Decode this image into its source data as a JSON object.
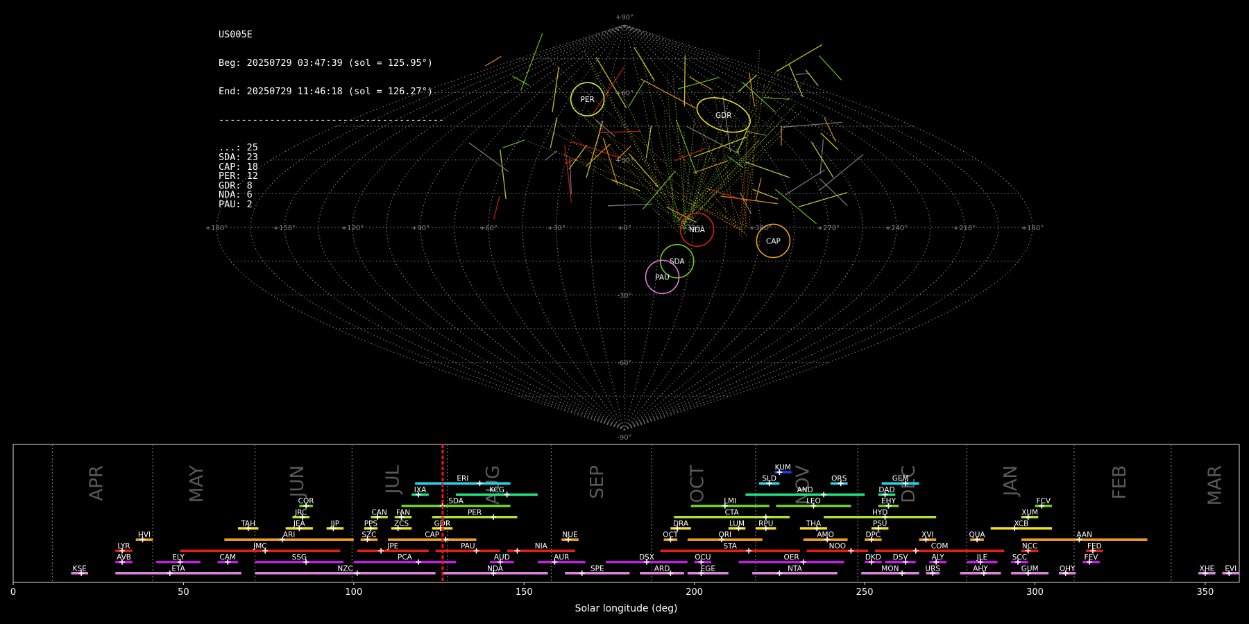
{
  "stats": {
    "station": "US005E",
    "beg": "Beg: 20250729 03:47:39 (sol = 125.95°)",
    "end": "End: 20250729 11:46:18 (sol = 126.27°)",
    "separator": "----------------------------------------",
    "counts": [
      {
        "code": "...",
        "count": 25
      },
      {
        "code": "SDA",
        "count": 23
      },
      {
        "code": "CAP",
        "count": 18
      },
      {
        "code": "PER",
        "count": 12
      },
      {
        "code": "GDR",
        "count": 8
      },
      {
        "code": "NDA",
        "count": 6
      },
      {
        "code": "PAU",
        "count": 2
      }
    ]
  },
  "chart_data": [
    {
      "type": "scatter",
      "projection": "sinusoidal",
      "lon_range": [
        180,
        -180
      ],
      "lat_range": [
        -90,
        90
      ],
      "lon_tick_labels": [
        "+180°",
        "+150°",
        "+120°",
        "+90°",
        "+60°",
        "+30°",
        "+0°",
        "+330°",
        "+300°",
        "+270°",
        "+240°",
        "+210°",
        "+180°"
      ],
      "lat_tick_labels": [
        "+90°",
        "+60°",
        "+30°",
        "+0°",
        "-30°",
        "-60°",
        "-90°"
      ],
      "grid": true,
      "radiants": [
        {
          "name": "PER",
          "lon": 30,
          "lat": 57,
          "color": "#c8f040"
        },
        {
          "name": "GDR",
          "lon": -68,
          "lat": 50,
          "color": "#f0e020"
        },
        {
          "name": "NDA",
          "lon": -32,
          "lat": -1,
          "color": "#e02010"
        },
        {
          "name": "CAP",
          "lon": -66,
          "lat": -6,
          "color": "#f0a020"
        },
        {
          "name": "SDA",
          "lon": -24,
          "lat": -15,
          "color": "#70d020"
        },
        {
          "name": "PAU",
          "lon": -18,
          "lat": -22,
          "color": "#e080e0"
        }
      ]
    },
    {
      "type": "timeline",
      "xlabel": "Solar longitude (deg)",
      "xlim": [
        0,
        360
      ],
      "x_ticks": [
        0,
        50,
        100,
        150,
        200,
        250,
        300,
        350
      ],
      "current_sol": 126.1,
      "months": [
        {
          "name": "APR",
          "start": 11.5,
          "label_at": 24.5
        },
        {
          "name": "MAY",
          "start": 41,
          "label_at": 54
        },
        {
          "name": "JUN",
          "start": 71,
          "label_at": 83.5
        },
        {
          "name": "JUL",
          "start": 99.5,
          "label_at": 111.5
        },
        {
          "name": "AUG",
          "start": 127.5,
          "label_at": 141
        },
        {
          "name": "SEP",
          "start": 158,
          "label_at": 171.5
        },
        {
          "name": "OCT",
          "start": 187.5,
          "label_at": 201
        },
        {
          "name": "NOV",
          "start": 218,
          "label_at": 232
        },
        {
          "name": "DEC",
          "start": 248,
          "label_at": 263
        },
        {
          "name": "JAN",
          "start": 280,
          "label_at": 293
        },
        {
          "name": "FEB",
          "start": 311.5,
          "label_at": 325
        },
        {
          "name": "MAR",
          "start": 340,
          "label_at": 353
        }
      ],
      "showers": [
        {
          "code": "KUM",
          "start": 223.5,
          "end": 228.5,
          "peak": 225,
          "row": 0,
          "color": "#2040f0"
        },
        {
          "code": "ERI",
          "start": 118,
          "end": 146,
          "peak": 137,
          "row": 1,
          "color": "#20d8f0"
        },
        {
          "code": "SLD",
          "start": 219,
          "end": 225,
          "peak": 222,
          "row": 1,
          "color": "#20d8f0"
        },
        {
          "code": "ORS",
          "start": 240,
          "end": 245,
          "peak": 243,
          "row": 1,
          "color": "#20d8f0"
        },
        {
          "code": "GEM",
          "start": 255,
          "end": 266,
          "peak": 262,
          "row": 1,
          "color": "#20d8f0"
        },
        {
          "code": "IXA",
          "start": 117,
          "end": 122,
          "peak": 119,
          "row": 2,
          "color": "#20e080"
        },
        {
          "code": "KCG",
          "start": 130,
          "end": 154,
          "peak": 145,
          "row": 2,
          "color": "#20e080"
        },
        {
          "code": "AND",
          "start": 215,
          "end": 250,
          "peak": 238,
          "row": 2,
          "color": "#20e080"
        },
        {
          "code": "DAD",
          "start": 254,
          "end": 259,
          "peak": 256,
          "row": 2,
          "color": "#20e080"
        },
        {
          "code": "COR",
          "start": 84,
          "end": 88,
          "peak": 86,
          "row": 3,
          "color": "#70d020"
        },
        {
          "code": "SDA",
          "start": 114,
          "end": 146,
          "peak": 126,
          "row": 3,
          "color": "#70d020"
        },
        {
          "code": "LMI",
          "start": 199,
          "end": 222,
          "peak": 209,
          "row": 3,
          "color": "#70d020"
        },
        {
          "code": "LEO",
          "start": 224,
          "end": 246,
          "peak": 235,
          "row": 3,
          "color": "#70d020"
        },
        {
          "code": "EHY",
          "start": 254,
          "end": 260,
          "peak": 257,
          "row": 3,
          "color": "#70d020"
        },
        {
          "code": "FCV",
          "start": 300,
          "end": 305,
          "peak": 302,
          "row": 3,
          "color": "#70d020"
        },
        {
          "code": "JRC",
          "start": 82,
          "end": 87,
          "peak": 85,
          "row": 4,
          "color": "#b0e030"
        },
        {
          "code": "CAN",
          "start": 105,
          "end": 110,
          "peak": 107,
          "row": 4,
          "color": "#b0e030"
        },
        {
          "code": "FAN",
          "start": 112,
          "end": 117,
          "peak": 114,
          "row": 4,
          "color": "#b0e030"
        },
        {
          "code": "PER",
          "start": 123,
          "end": 148,
          "peak": 141,
          "row": 4,
          "color": "#b0e030"
        },
        {
          "code": "CTA",
          "start": 194,
          "end": 228,
          "peak": 221,
          "row": 4,
          "color": "#b0e030"
        },
        {
          "code": "HYD",
          "start": 238,
          "end": 271,
          "peak": 256,
          "row": 4,
          "color": "#b0e030"
        },
        {
          "code": "XUM",
          "start": 296,
          "end": 301,
          "peak": 298,
          "row": 4,
          "color": "#b0e030"
        },
        {
          "code": "TAH",
          "start": 66,
          "end": 72,
          "peak": 69,
          "row": 5,
          "color": "#f0e020"
        },
        {
          "code": "JEA",
          "start": 80,
          "end": 88,
          "peak": 84,
          "row": 5,
          "color": "#f0e020"
        },
        {
          "code": "JIP",
          "start": 92,
          "end": 97,
          "peak": 94,
          "row": 5,
          "color": "#f0e020"
        },
        {
          "code": "PPS",
          "start": 103,
          "end": 107,
          "peak": 105,
          "row": 5,
          "color": "#f0e020"
        },
        {
          "code": "ZCS",
          "start": 111,
          "end": 117,
          "peak": 113,
          "row": 5,
          "color": "#f0e020"
        },
        {
          "code": "GDR",
          "start": 123,
          "end": 129,
          "peak": 125.5,
          "row": 5,
          "color": "#f0e020"
        },
        {
          "code": "DRA",
          "start": 193,
          "end": 199,
          "peak": 195,
          "row": 5,
          "color": "#f0e020"
        },
        {
          "code": "LUM",
          "start": 210,
          "end": 215,
          "peak": 213,
          "row": 5,
          "color": "#f0e020"
        },
        {
          "code": "RPU",
          "start": 218,
          "end": 224,
          "peak": 221,
          "row": 5,
          "color": "#f0e020"
        },
        {
          "code": "THA",
          "start": 231,
          "end": 239,
          "peak": 236,
          "row": 5,
          "color": "#f0e020"
        },
        {
          "code": "PSU",
          "start": 252,
          "end": 257,
          "peak": 254,
          "row": 5,
          "color": "#f0e020"
        },
        {
          "code": "XCB",
          "start": 287,
          "end": 305,
          "peak": 294,
          "row": 5,
          "color": "#f0e020"
        },
        {
          "code": "HVI",
          "start": 36,
          "end": 41,
          "peak": 38,
          "row": 6,
          "color": "#f0a020"
        },
        {
          "code": "ARI",
          "start": 62,
          "end": 100,
          "peak": 79,
          "row": 6,
          "color": "#f0a020"
        },
        {
          "code": "SZC",
          "start": 102,
          "end": 107,
          "peak": 104,
          "row": 6,
          "color": "#f0a020"
        },
        {
          "code": "CAP",
          "start": 110,
          "end": 136,
          "peak": 127,
          "row": 6,
          "color": "#f0a020"
        },
        {
          "code": "NUE",
          "start": 161,
          "end": 166,
          "peak": 163,
          "row": 6,
          "color": "#f0a020"
        },
        {
          "code": "OCT",
          "start": 191,
          "end": 195,
          "peak": 193,
          "row": 6,
          "color": "#f0a020"
        },
        {
          "code": "ORI",
          "start": 198,
          "end": 220,
          "peak": 208,
          "row": 6,
          "color": "#f0a020"
        },
        {
          "code": "AMO",
          "start": 232,
          "end": 245,
          "peak": 239,
          "row": 6,
          "color": "#f0a020"
        },
        {
          "code": "DPC",
          "start": 250,
          "end": 255,
          "peak": 252,
          "row": 6,
          "color": "#f0a020"
        },
        {
          "code": "XVI",
          "start": 266,
          "end": 271,
          "peak": 268,
          "row": 6,
          "color": "#f0a020"
        },
        {
          "code": "QUA",
          "start": 281,
          "end": 285,
          "peak": 283,
          "row": 6,
          "color": "#f0a020"
        },
        {
          "code": "AAN",
          "start": 296,
          "end": 333,
          "peak": 313,
          "row": 6,
          "color": "#f0a020"
        },
        {
          "code": "LYR",
          "start": 30,
          "end": 35,
          "peak": 32,
          "row": 7,
          "color": "#e02010"
        },
        {
          "code": "JMC",
          "start": 49,
          "end": 96,
          "peak": 74,
          "row": 7,
          "color": "#e02010"
        },
        {
          "code": "JPE",
          "start": 101,
          "end": 122,
          "peak": 108,
          "row": 7,
          "color": "#e02010"
        },
        {
          "code": "PAU",
          "start": 124,
          "end": 143,
          "peak": 136,
          "row": 7,
          "color": "#e02010"
        },
        {
          "code": "NIA",
          "start": 145,
          "end": 165,
          "peak": 148,
          "row": 7,
          "color": "#e02010"
        },
        {
          "code": "STA",
          "start": 190,
          "end": 231,
          "peak": 216,
          "row": 7,
          "color": "#e02010"
        },
        {
          "code": "NOO",
          "start": 233,
          "end": 251,
          "peak": 246,
          "row": 7,
          "color": "#e02010"
        },
        {
          "code": "COM",
          "start": 253,
          "end": 291,
          "peak": 265,
          "row": 7,
          "color": "#e02010"
        },
        {
          "code": "NCC",
          "start": 296,
          "end": 301,
          "peak": 298,
          "row": 7,
          "color": "#e02010"
        },
        {
          "code": "FED",
          "start": 315,
          "end": 320,
          "peak": 317,
          "row": 7,
          "color": "#e02010"
        },
        {
          "code": "AVB",
          "start": 30,
          "end": 35,
          "peak": 32,
          "row": 8,
          "color": "#c020e0"
        },
        {
          "code": "ELY",
          "start": 42,
          "end": 55,
          "peak": 49,
          "row": 8,
          "color": "#c020e0"
        },
        {
          "code": "CAM",
          "start": 60,
          "end": 66,
          "peak": 63,
          "row": 8,
          "color": "#c020e0"
        },
        {
          "code": "SSG",
          "start": 71,
          "end": 97,
          "peak": 86,
          "row": 8,
          "color": "#c020e0"
        },
        {
          "code": "PCA",
          "start": 100,
          "end": 130,
          "peak": 119,
          "row": 8,
          "color": "#c020e0"
        },
        {
          "code": "AUD",
          "start": 140,
          "end": 147,
          "peak": 143,
          "row": 8,
          "color": "#c020e0"
        },
        {
          "code": "AUR",
          "start": 154,
          "end": 168,
          "peak": 159,
          "row": 8,
          "color": "#c020e0"
        },
        {
          "code": "DSX",
          "start": 174,
          "end": 198,
          "peak": 186,
          "row": 8,
          "color": "#c020e0"
        },
        {
          "code": "OCU",
          "start": 200,
          "end": 205,
          "peak": 202,
          "row": 8,
          "color": "#c020e0"
        },
        {
          "code": "OER",
          "start": 213,
          "end": 244,
          "peak": 232,
          "row": 8,
          "color": "#c020e0"
        },
        {
          "code": "DKD",
          "start": 250,
          "end": 255,
          "peak": 252,
          "row": 8,
          "color": "#c020e0"
        },
        {
          "code": "DSV",
          "start": 256,
          "end": 265,
          "peak": 262,
          "row": 8,
          "color": "#c020e0"
        },
        {
          "code": "ALY",
          "start": 269,
          "end": 274,
          "peak": 271,
          "row": 8,
          "color": "#c020e0"
        },
        {
          "code": "JLE",
          "start": 280,
          "end": 289,
          "peak": 284,
          "row": 8,
          "color": "#c020e0"
        },
        {
          "code": "SCC",
          "start": 293,
          "end": 298,
          "peak": 295,
          "row": 8,
          "color": "#c020e0"
        },
        {
          "code": "FEV",
          "start": 314,
          "end": 319,
          "peak": 316,
          "row": 8,
          "color": "#c020e0"
        },
        {
          "code": "KSE",
          "start": 17,
          "end": 22,
          "peak": 20,
          "row": 9,
          "color": "#e080e0"
        },
        {
          "code": "ETA",
          "start": 30,
          "end": 67,
          "peak": 46,
          "row": 9,
          "color": "#e080e0"
        },
        {
          "code": "NZC",
          "start": 71,
          "end": 124,
          "peak": 101,
          "row": 9,
          "color": "#e080e0"
        },
        {
          "code": "NDA",
          "start": 126,
          "end": 157,
          "peak": 141,
          "row": 9,
          "color": "#e080e0"
        },
        {
          "code": "SPE",
          "start": 162,
          "end": 181,
          "peak": 167,
          "row": 9,
          "color": "#e080e0"
        },
        {
          "code": "ARD",
          "start": 184,
          "end": 197,
          "peak": 193,
          "row": 9,
          "color": "#e080e0"
        },
        {
          "code": "EGE",
          "start": 198,
          "end": 210,
          "peak": 202,
          "row": 9,
          "color": "#e080e0"
        },
        {
          "code": "NTA",
          "start": 217,
          "end": 242,
          "peak": 225,
          "row": 9,
          "color": "#e080e0"
        },
        {
          "code": "MON",
          "start": 249,
          "end": 266,
          "peak": 261,
          "row": 9,
          "color": "#e080e0"
        },
        {
          "code": "URS",
          "start": 268,
          "end": 272,
          "peak": 270,
          "row": 9,
          "color": "#e080e0"
        },
        {
          "code": "AHY",
          "start": 278,
          "end": 290,
          "peak": 285,
          "row": 9,
          "color": "#e080e0"
        },
        {
          "code": "GUM",
          "start": 293,
          "end": 304,
          "peak": 298,
          "row": 9,
          "color": "#e080e0"
        },
        {
          "code": "OHY",
          "start": 307,
          "end": 312,
          "peak": 309,
          "row": 9,
          "color": "#e080e0"
        },
        {
          "code": "XHE",
          "start": 348,
          "end": 353,
          "peak": 350,
          "row": 9,
          "color": "#e080e0"
        },
        {
          "code": "EVI",
          "start": 355,
          "end": 360,
          "peak": 357,
          "row": 9,
          "color": "#e080e0"
        }
      ]
    }
  ]
}
